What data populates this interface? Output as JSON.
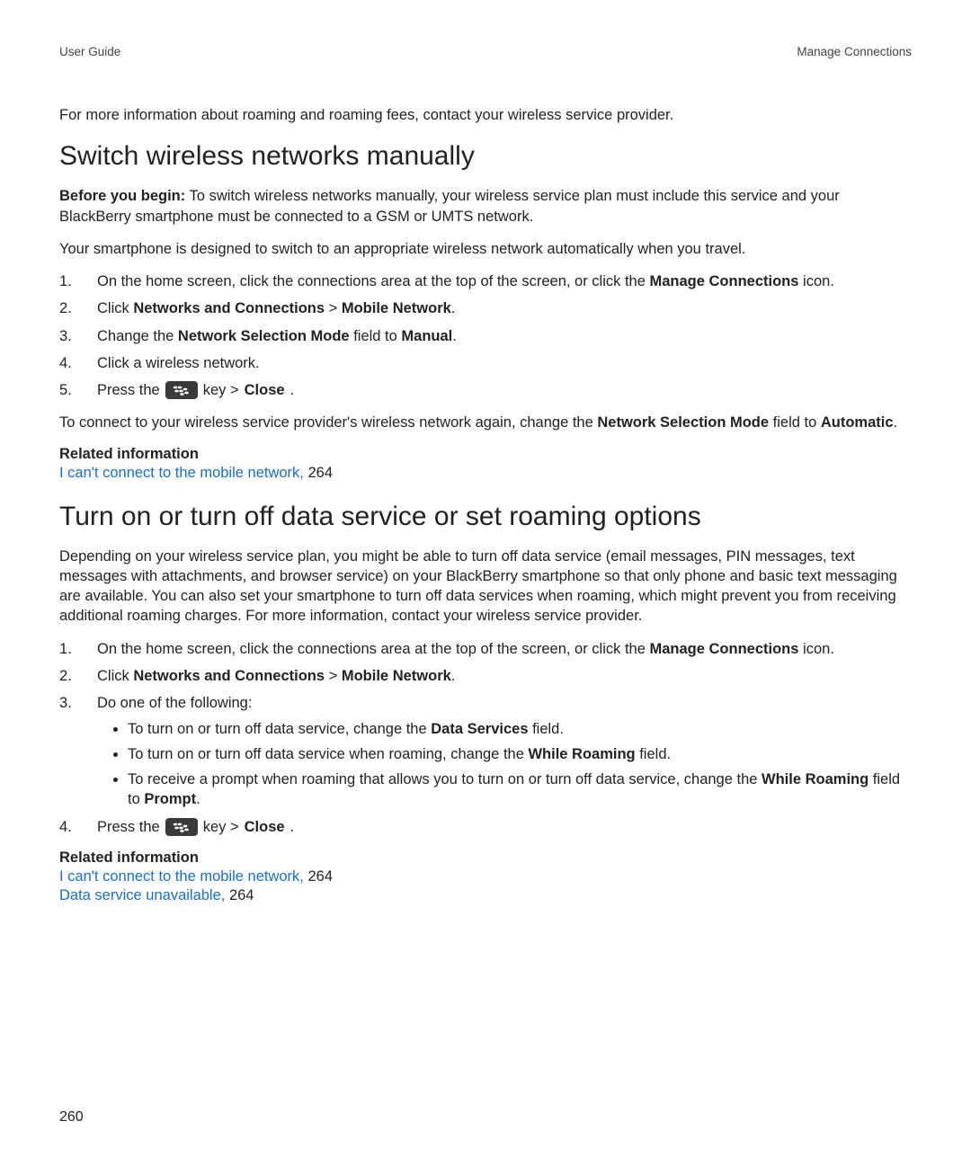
{
  "header": {
    "left": "User Guide",
    "right": "Manage Connections"
  },
  "intro": "For more information about roaming and roaming fees, contact your wireless service provider.",
  "section1": {
    "title": "Switch wireless networks manually",
    "before_label": "Before you begin:",
    "before_text": " To switch wireless networks manually, your wireless service plan must include this service and your BlackBerry smartphone must be connected to a GSM or UMTS network.",
    "auto_note": "Your smartphone is designed to switch to an appropriate wireless network automatically when you travel.",
    "steps": {
      "s1_a": "On the home screen, click the connections area at the top of the screen, or click the ",
      "s1_b": "Manage Connections",
      "s1_c": " icon.",
      "s2_a": "Click ",
      "s2_b": "Networks and Connections",
      "s2_sep": " > ",
      "s2_c": "Mobile Network",
      "s2_d": ".",
      "s3_a": "Change the ",
      "s3_b": "Network Selection Mode",
      "s3_c": " field to ",
      "s3_d": "Manual",
      "s3_e": ".",
      "s4": "Click a wireless network.",
      "s5_a": "Press the ",
      "s5_b": " key > ",
      "s5_c": "Close",
      "s5_d": "."
    },
    "reconnect_a": "To connect to your wireless service provider's wireless network again, change the ",
    "reconnect_b": "Network Selection Mode",
    "reconnect_c": " field to ",
    "reconnect_d": "Automatic",
    "reconnect_e": ".",
    "related_heading": "Related information",
    "related_link": "I can't connect to the mobile network,",
    "related_page": " 264"
  },
  "section2": {
    "title": "Turn on or turn off data service or set roaming options",
    "para": "Depending on your wireless service plan, you might be able to turn off data service (email messages, PIN messages, text messages with attachments, and browser service) on your BlackBerry smartphone so that only phone and basic text messaging are available. You can also set your smartphone to turn off data services when roaming, which might prevent you from receiving additional roaming charges. For more information, contact your wireless service provider.",
    "steps": {
      "s1_a": "On the home screen, click the connections area at the top of the screen, or click the ",
      "s1_b": "Manage Connections",
      "s1_c": " icon.",
      "s2_a": "Click ",
      "s2_b": "Networks and Connections",
      "s2_sep": " > ",
      "s2_c": "Mobile Network",
      "s2_d": ".",
      "s3": "Do one of the following:",
      "b1_a": "To turn on or turn off data service, change the ",
      "b1_b": "Data Services",
      "b1_c": " field.",
      "b2_a": "To turn on or turn off data service when roaming, change the ",
      "b2_b": "While Roaming",
      "b2_c": " field.",
      "b3_a": "To receive a prompt when roaming that allows you to turn on or turn off data service, change the ",
      "b3_b": "While Roaming",
      "b3_c": " field to ",
      "b3_d": "Prompt",
      "b3_e": ".",
      "s4_a": "Press the ",
      "s4_b": " key > ",
      "s4_c": "Close",
      "s4_d": "."
    },
    "related_heading": "Related information",
    "rel1_link": "I can't connect to the mobile network,",
    "rel1_page": " 264",
    "rel2_link": "Data service unavailable,",
    "rel2_page": " 264"
  },
  "page_number": "260"
}
